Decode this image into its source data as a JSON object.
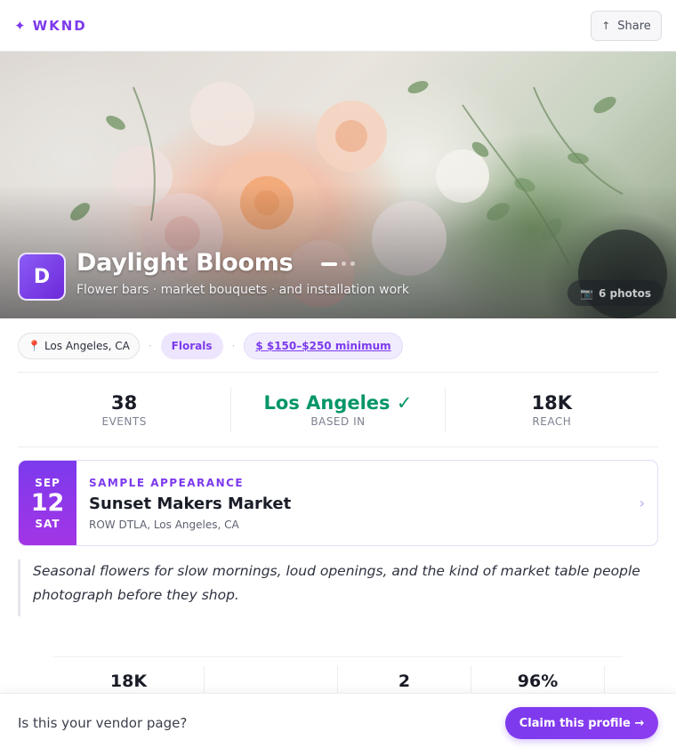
{
  "header": {
    "brand_mark": "✦",
    "brand_name": "WKND",
    "share_icon": "↑",
    "share_label": "Share"
  },
  "hero": {
    "avatar_initial": "D",
    "vendor_name": "Daylight Blooms",
    "tagline": "Flower bars · market bouquets · and installation work",
    "carousel": {
      "total": 3,
      "active": 1
    },
    "photos_icon": "📷",
    "photos_label": "6 photos"
  },
  "tags": {
    "location_icon": "📍",
    "location": "Los Angeles, CA",
    "separator": "·",
    "category": "Florals",
    "price": "$ $150–$250 minimum"
  },
  "stats": [
    {
      "value": "38",
      "label": "EVENTS"
    },
    {
      "value": "Los Angeles ✓",
      "label": "BASED IN"
    },
    {
      "value": "18K",
      "label": "REACH"
    }
  ],
  "event": {
    "month": "SEP",
    "day": "12",
    "weekday": "SAT",
    "kicker": "SAMPLE APPEARANCE",
    "title": "Sunset Makers Market",
    "venue": "ROW DTLA, Los Angeles, CA",
    "chevron": "›"
  },
  "quote": "Seasonal flowers for slow mornings, loud openings, and the kind of market table people photograph before they shop.",
  "lower_stats": [
    "18K",
    "",
    "2",
    "96%"
  ],
  "claim": {
    "question": "Is this your vendor page?",
    "button": "Claim this profile →"
  },
  "colors": {
    "accent": "#7c3aed",
    "success": "#059669"
  }
}
